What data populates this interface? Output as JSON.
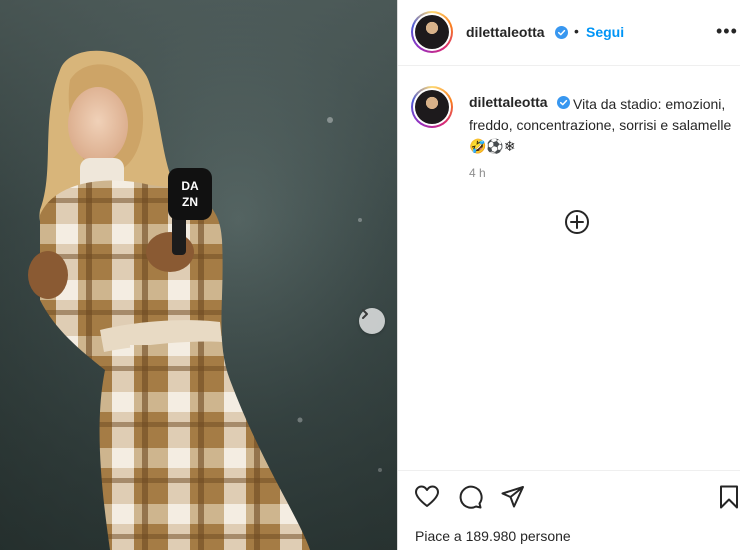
{
  "post": {
    "username": "dilettaleotta",
    "follow_label": "Segui",
    "separator": "•",
    "more_label": "•••",
    "caption_text": "Vita da stadio: emozioni, freddo, concentrazione, sorrisi e salamelle",
    "caption_emojis": "🤣⚽❄",
    "time_ago": "4 h",
    "likes_text": "Piace a 189.980 persone"
  },
  "media": {
    "microphone_logo_line1": "DA",
    "microphone_logo_line2": "ZN"
  },
  "colors": {
    "accent": "#0095f6",
    "verified": "#3897f0",
    "text": "#262626",
    "muted": "#8e8e8e"
  },
  "icons": {
    "next": "chevron-right-icon",
    "add": "plus-circle-icon",
    "like": "heart-icon",
    "comment": "comment-icon",
    "share": "paper-plane-icon",
    "save": "bookmark-icon",
    "verified": "verified-badge-icon",
    "more": "more-options-icon"
  }
}
